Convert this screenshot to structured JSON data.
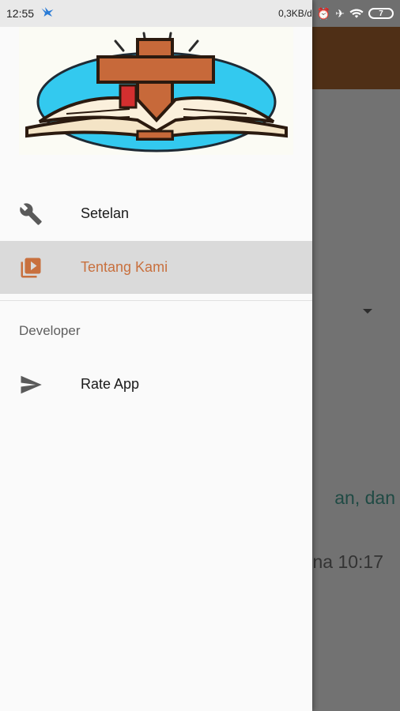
{
  "status_bar": {
    "time": "12:55",
    "speed": "0,3KB/d",
    "battery": "7"
  },
  "drawer": {
    "menu": [
      {
        "label": "Setelan",
        "icon": "wrench-icon"
      },
      {
        "label": "Tentang Kami",
        "icon": "video-library-icon",
        "selected": true
      }
    ],
    "section_title": "Developer",
    "developer_items": [
      {
        "label": "Rate App",
        "icon": "send-icon"
      }
    ]
  },
  "background": {
    "text_line_1": "an, dan",
    "text_line_2": "na 10:17"
  },
  "colors": {
    "accent": "#c8703e",
    "toolbar": "#4f2f16",
    "selected_bg": "#dadada"
  }
}
